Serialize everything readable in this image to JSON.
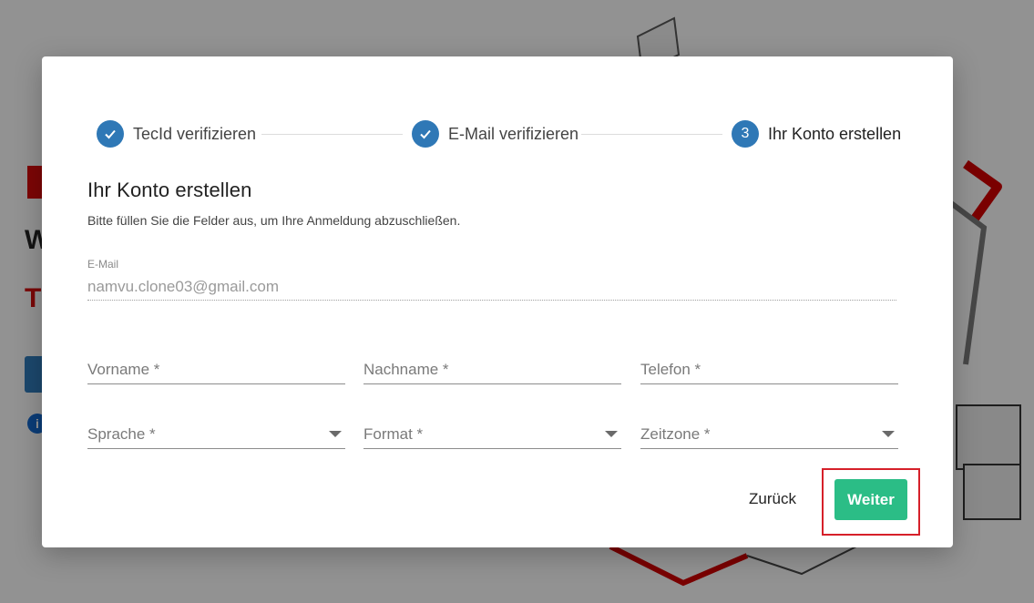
{
  "background": {
    "heading_letter": "W",
    "accent_letter": "T",
    "info_glyph": "i"
  },
  "stepper": {
    "steps": [
      {
        "label": "TecId verifizieren",
        "state": "done",
        "icon": "check-icon"
      },
      {
        "label": "E-Mail verifizieren",
        "state": "done",
        "icon": "check-icon"
      },
      {
        "label": "Ihr Konto erstellen",
        "state": "active",
        "number": "3"
      }
    ]
  },
  "form": {
    "title": "Ihr Konto erstellen",
    "subtitle": "Bitte füllen Sie die Felder aus, um Ihre Anmeldung abzuschließen.",
    "email": {
      "label": "E-Mail",
      "value": "namvu.clone03@gmail.com"
    },
    "fields": {
      "first_name": "Vorname *",
      "last_name": "Nachname *",
      "phone": "Telefon *",
      "language": "Sprache *",
      "format": "Format *",
      "timezone": "Zeitzone *"
    },
    "back_label": "Zurück",
    "next_label": "Weiter"
  },
  "colors": {
    "primary": "#2f78b6",
    "button": "#2bbd86",
    "highlight": "#d6202a",
    "brand_red": "#d10a0a"
  }
}
